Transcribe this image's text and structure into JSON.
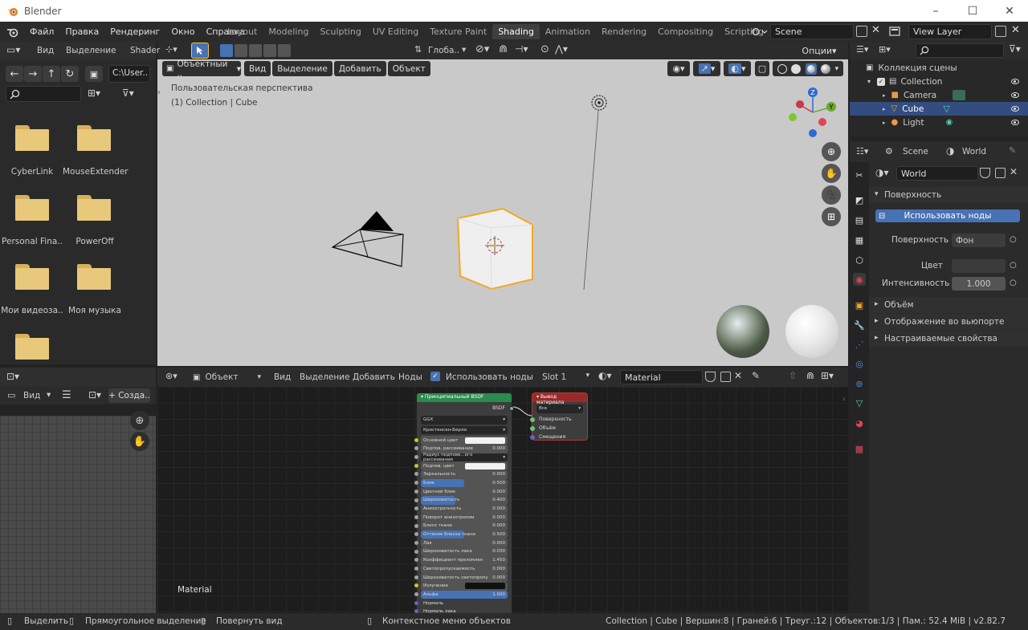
{
  "window": {
    "title": "Blender",
    "controls": [
      "–",
      "☐",
      "✕"
    ]
  },
  "menu": [
    "Файл",
    "Правка",
    "Рендеринг",
    "Окно",
    "Справка"
  ],
  "workspaces": [
    "Layout",
    "Modeling",
    "Sculpting",
    "UV Editing",
    "Texture Paint",
    "Shading",
    "Animation",
    "Rendering",
    "Compositing",
    "Scripting"
  ],
  "active_workspace": "Shading",
  "scene_field": "Scene",
  "view_layer_field": "View Layer",
  "file_browser": {
    "header": {
      "view": "Вид",
      "select": "Выделение"
    },
    "path": "C:\\User..",
    "items": [
      "CyberLink",
      "MouseExtender",
      "Personal Fina..",
      "PowerOff",
      "Мои видеоза..",
      "Моя музыка",
      ""
    ]
  },
  "image_editor": {
    "view": "Вид",
    "new_button": "+ Созда.."
  },
  "viewport": {
    "editor_label": "Shader",
    "orientation": "Глоба..",
    "options": "Опции",
    "mode": "Объектный ..",
    "menus": [
      "Вид",
      "Выделение",
      "Добавить",
      "Объект"
    ],
    "perspective": "Пользовательская перспектива",
    "collection_info": "(1) Collection | Cube"
  },
  "node_editor": {
    "mode": "Объект",
    "menus": [
      "Вид",
      "Выделение",
      "Добавить",
      "Ноды"
    ],
    "use_nodes_label": "Использовать ноды",
    "slot": "Slot 1",
    "material": "Material",
    "footer_label": "Material",
    "bsdf_node": {
      "title": "Принципиальный BSDF",
      "output": "BSDF",
      "distribution": "GGX",
      "subsurface_method": "Кристенсен-Берли",
      "rows": [
        {
          "label": "Основной цвет",
          "value": "",
          "kind": "color"
        },
        {
          "label": "Подпов. рассеивание",
          "value": "0.000"
        },
        {
          "label": "Радиус подпове...ого рассеивания",
          "value": "",
          "kind": "select"
        },
        {
          "label": "Подпов. цвет",
          "value": "",
          "kind": "color"
        },
        {
          "label": "Зеркальность",
          "value": "0.000"
        },
        {
          "label": "Блик",
          "value": "0.500",
          "fill": 0.5
        },
        {
          "label": "Цветной блик",
          "value": "0.000"
        },
        {
          "label": "Шероховатость",
          "value": "0.400",
          "fill": 0.4
        },
        {
          "label": "Анизотропность",
          "value": "0.000"
        },
        {
          "label": "Поворот анизотропии",
          "value": "0.000"
        },
        {
          "label": "Блеск ткани",
          "value": "0.000"
        },
        {
          "label": "Оттенок блеска ткани",
          "value": "0.500",
          "fill": 0.5
        },
        {
          "label": "Лак",
          "value": "0.000"
        },
        {
          "label": "Шероховатость лака",
          "value": "0.030"
        },
        {
          "label": "Коэффициент преломлен",
          "value": "1.450"
        },
        {
          "label": "Светопропускаемость",
          "value": "0.000"
        },
        {
          "label": "Шероховатость светопропу",
          "value": "0.000"
        },
        {
          "label": "Излучение",
          "value": "",
          "kind": "dark"
        },
        {
          "label": "Альфа",
          "value": "1.000",
          "fill": 1.0
        },
        {
          "label": "Нормаль",
          "value": "",
          "kind": "plain"
        },
        {
          "label": "Нормаль лака",
          "value": "",
          "kind": "plain"
        }
      ]
    },
    "output_node": {
      "title": "Вывод материала",
      "target": "Все",
      "sockets": [
        "Поверхность",
        "Объём",
        "Смещения"
      ]
    }
  },
  "outliner": {
    "scene_collection": "Коллекция сцены",
    "items": [
      {
        "label": "Collection",
        "icon": "collection-icon",
        "level": 1,
        "selected": false
      },
      {
        "label": "Camera",
        "icon": "camera-icon",
        "level": 2,
        "selected": false
      },
      {
        "label": "Cube",
        "icon": "mesh-icon",
        "level": 2,
        "selected": true
      },
      {
        "label": "Light",
        "icon": "light-icon",
        "level": 2,
        "selected": false
      }
    ]
  },
  "properties": {
    "tabs": [
      "Scene",
      "World"
    ],
    "world_name": "World",
    "surface_panel": "Поверхность",
    "use_nodes_button": "Использовать ноды",
    "surface_label": "Поверхность",
    "surface_value": "Фон",
    "color_label": "Цвет",
    "strength_label": "Интенсивность",
    "strength_value": "1.000",
    "collapsed_panels": [
      "Объём",
      "Отображение во вьюпорте",
      "Настраиваемые свойства"
    ]
  },
  "status_bar": {
    "select": "Выделить",
    "box_select": "Прямоугольное выделение",
    "rotate": "Повернуть вид",
    "context_menu": "Контекстное меню объектов",
    "stats": "Collection | Cube | Вершин:8 | Граней:6 | Треуг.:12 | Объектов:1/3 | Пам.: 52.4 MiB | v2.82.7"
  },
  "colors": {
    "accent_blue": "#4772b3",
    "selection_orange": "#f5a623",
    "bsdf_header": "#2b8a4e",
    "output_header": "#9a2a2a",
    "viewport_bg": "#c9c9c9"
  }
}
